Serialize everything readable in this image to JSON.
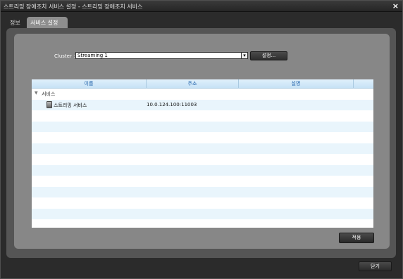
{
  "window": {
    "title": "스트리밍 장애조치 서비스 설정 - 스트리밍 장애조치 서비스",
    "close_glyph": "×"
  },
  "tabs": [
    {
      "label": "정보",
      "active": false
    },
    {
      "label": "서비스 설정",
      "active": true
    }
  ],
  "cluster": {
    "label": "Cluster :",
    "selected": "Streaming 1",
    "settings_button": "설정..."
  },
  "table": {
    "columns": [
      "이름",
      "주소",
      "설명",
      ""
    ],
    "group": {
      "label": "서비스",
      "expanded": true
    },
    "rows": [
      {
        "icon": "server-icon",
        "name": "스트리밍 서비스",
        "address": "10.0.124.100:11003",
        "description": ""
      }
    ]
  },
  "buttons": {
    "apply": "적용",
    "close": "닫기"
  },
  "colors": {
    "header_text": "#1c5fa8",
    "row_alt": "#e9f5fc",
    "panel_outer": "#555555",
    "panel_inner": "#878787"
  }
}
